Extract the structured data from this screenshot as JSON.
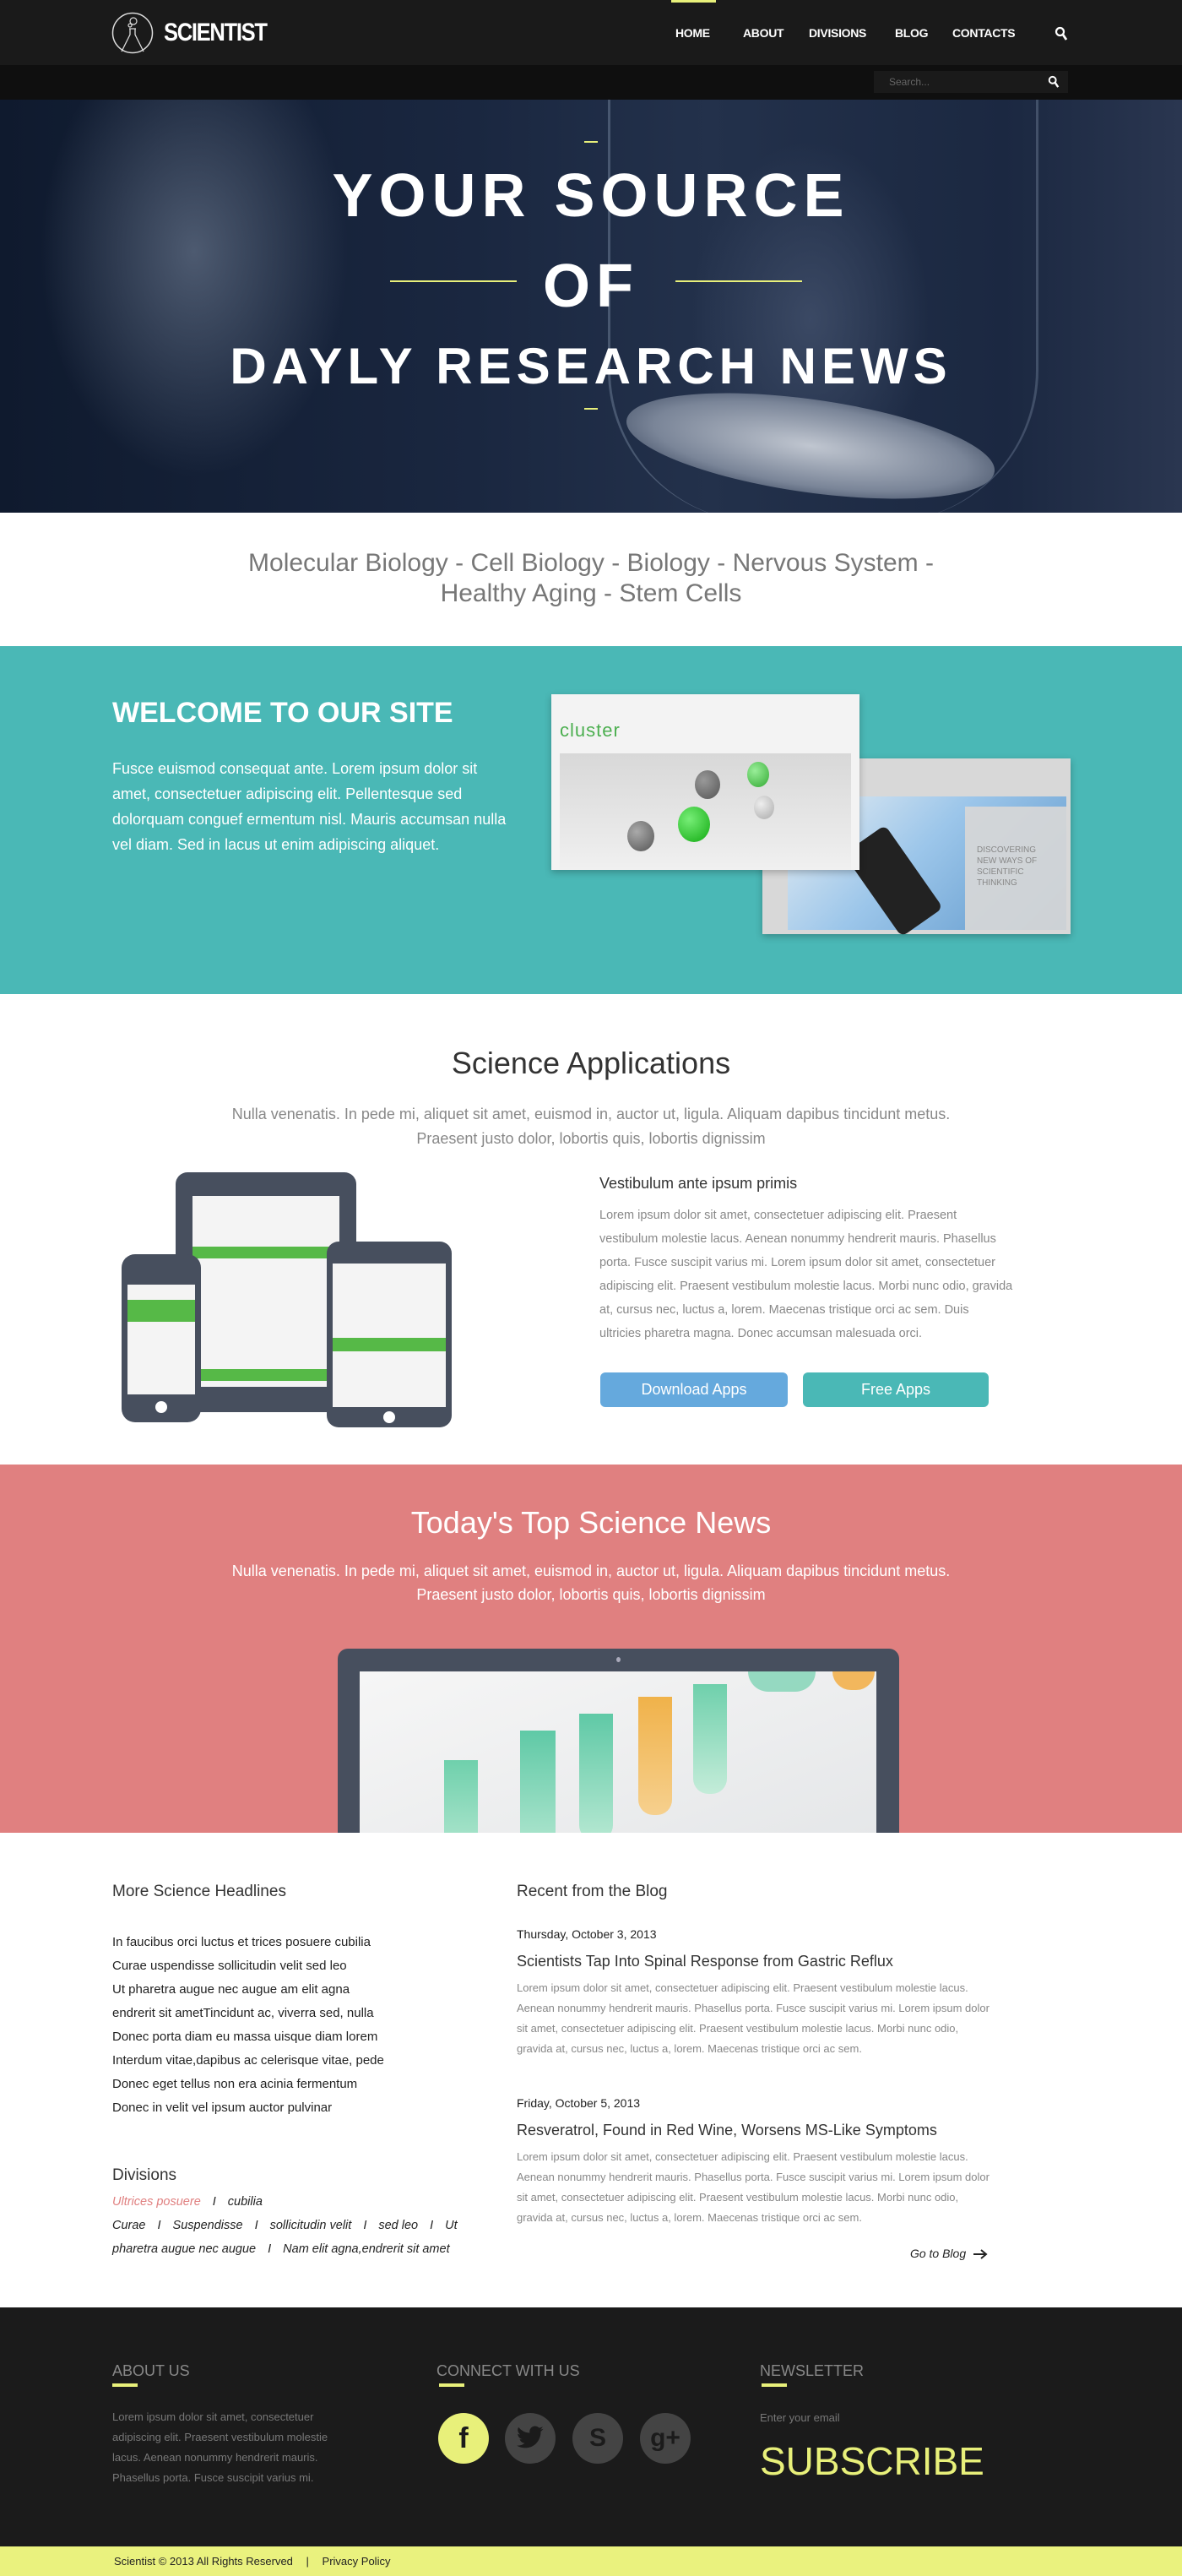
{
  "colors": {
    "accent": "#e8f07a",
    "teal": "#4ab8b6",
    "coral": "#e08080",
    "blue_button": "#65a9dd",
    "dark": "#1b1b1b"
  },
  "header": {
    "logo_text": "SCIENTIST",
    "nav": [
      {
        "label": "HOME",
        "active": true
      },
      {
        "label": "ABOUT"
      },
      {
        "label": "DIVISIONS"
      },
      {
        "label": "BLOG"
      },
      {
        "label": "CONTACTS"
      }
    ],
    "search_icon": "search-icon",
    "search_placeholder": "Search..."
  },
  "hero": {
    "line1": "YOUR SOURCE",
    "line2": "OF",
    "line3": "DAYLY RESEARCH NEWS"
  },
  "tags": "Molecular Biology - Cell Biology - Biology - Nervous System - Healthy Aging - Stem Cells",
  "welcome": {
    "title": "WELCOME TO OUR SITE",
    "text": "Fusce euismod consequat ante. Lorem ipsum dolor sit amet, consectetuer adipiscing elit. Pellentesque sed dolorquam conguef ermentum nisl. Mauris accumsan nulla vel diam. Sed in lacus ut enim adipiscing aliquet.",
    "shot1_logo": "cluster",
    "shot2_text": "DISCOVERING NEW WAYS OF SCIENTIFIC THINKING"
  },
  "apps": {
    "title": "Science Applications",
    "subtitle": "Nulla venenatis. In pede mi, aliquet sit amet, euismod in, auctor ut, ligula. Aliquam dapibus tincidunt metus. Praesent justo dolor, lobortis quis, lobortis dignissim",
    "heading": "Vestibulum ante ipsum primis",
    "text": "Lorem ipsum dolor sit amet, consectetuer adipiscing elit. Praesent vestibulum molestie lacus. Aenean nonummy hendrerit mauris. Phasellus porta. Fusce suscipit varius mi. Lorem ipsum dolor sit amet, consectetuer adipiscing elit. Praesent vestibulum molestie lacus. Morbi nunc odio, gravida at, cursus nec, luctus a, lorem. Maecenas tristique orci ac sem. Duis ultricies pharetra magna. Donec accumsan malesuada orci.",
    "download_label": "Download Apps",
    "free_label": "Free Apps"
  },
  "news": {
    "title": "Today's Top Science News",
    "subtitle": "Nulla venenatis. In pede mi, aliquet sit amet, euismod in, auctor ut, ligula. Aliquam dapibus tincidunt metus. Praesent justo dolor, lobortis quis, lobortis dignissim"
  },
  "headlines": {
    "title": "More Science Headlines",
    "items": [
      "In faucibus orci luctus et trices posuere cubilia",
      "Curae uspendisse sollicitudin velit sed leo",
      "Ut pharetra augue nec augue am elit agna",
      "endrerit sit ametTincidunt ac, viverra sed, nulla",
      "Donec porta diam eu massa uisque diam lorem",
      "Interdum vitae,dapibus ac celerisque vitae, pede",
      "Donec eget tellus non era acinia fermentum",
      "Donec in velit vel ipsum auctor pulvinar"
    ]
  },
  "divisions": {
    "title": "Divisions",
    "items": [
      "Ultrices posuere",
      "cubilia Curae",
      "Suspendisse",
      "sollicitudin velit",
      "sed leo",
      "Ut pharetra augue nec augue",
      "Nam elit agna,endrerit sit amet"
    ],
    "separator": "I"
  },
  "blog": {
    "title": "Recent from the Blog",
    "posts": [
      {
        "date": "Thursday, October 3, 2013",
        "title": "Scientists Tap Into Spinal Response from Gastric Reflux",
        "body": "Lorem ipsum dolor sit amet, consectetuer adipiscing elit. Praesent vestibulum molestie lacus. Aenean nonummy hendrerit mauris. Phasellus porta. Fusce suscipit varius mi. Lorem ipsum dolor sit amet, consectetuer adipiscing elit. Praesent vestibulum molestie lacus. Morbi nunc odio, gravida at, cursus nec, luctus a, lorem. Maecenas tristique orci ac sem."
      },
      {
        "date": "Friday, October 5, 2013",
        "title": "Resveratrol, Found in Red Wine, Worsens MS-Like Symptoms",
        "body": "Lorem ipsum dolor sit amet, consectetuer adipiscing elit. Praesent vestibulum molestie lacus. Aenean nonummy hendrerit mauris. Phasellus porta. Fusce suscipit varius mi. Lorem ipsum dolor sit amet, consectetuer adipiscing elit. Praesent vestibulum molestie lacus. Morbi nunc odio, gravida at, cursus nec, luctus a, lorem. Maecenas tristique orci ac sem."
      }
    ],
    "go_label": "Go to Blog"
  },
  "footer": {
    "about_title": "ABOUT US",
    "about_text": "Lorem ipsum dolor sit amet, consectetuer adipiscing elit. Praesent vestibulum molestie lacus. Aenean nonummy hendrerit mauris. Phasellus porta. Fusce suscipit varius mi.",
    "connect_title": "CONNECT WITH US",
    "social": [
      {
        "icon": "facebook-icon",
        "glyph": "f"
      },
      {
        "icon": "twitter-icon",
        "glyph": "t"
      },
      {
        "icon": "skype-icon",
        "glyph": "S"
      },
      {
        "icon": "google-plus-icon",
        "glyph": "g+"
      }
    ],
    "newsletter_title": "NEWSLETTER",
    "email_placeholder": "Enter your email",
    "subscribe_label": "SUBSCRIBE",
    "copyright": "Scientist © 2013 All Rights Reserved",
    "privacy": "Privacy Policy"
  }
}
